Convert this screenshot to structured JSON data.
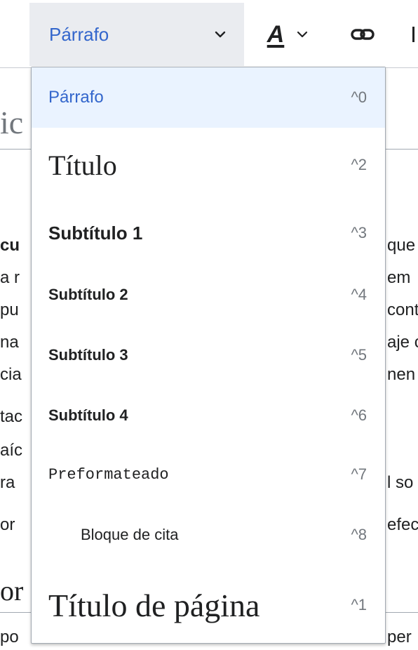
{
  "toolbar": {
    "format_label": "Párrafo",
    "text_style_glyph": "A"
  },
  "background_fragments": {
    "left_heading": "ic",
    "left": [
      "cu",
      "a r",
      "pu",
      "na",
      "cia",
      "tac",
      "aíc",
      "ra",
      "or",
      "or",
      "po"
    ],
    "right": [
      "que",
      "em",
      "cont",
      "aje c",
      "nen",
      "l so",
      "efec",
      "per"
    ]
  },
  "menu": {
    "items": [
      {
        "label": "Párrafo",
        "shortcut": "^0"
      },
      {
        "label": "Título",
        "shortcut": "^2"
      },
      {
        "label": "Subtítulo 1",
        "shortcut": "^3"
      },
      {
        "label": "Subtítulo 2",
        "shortcut": "^4"
      },
      {
        "label": "Subtítulo 3",
        "shortcut": "^5"
      },
      {
        "label": "Subtítulo 4",
        "shortcut": "^6"
      },
      {
        "label": "Preformateado",
        "shortcut": "^7"
      },
      {
        "label": "Bloque de cita",
        "shortcut": "^8"
      },
      {
        "label": "Título de página",
        "shortcut": "^1"
      }
    ]
  },
  "colors": {
    "accent": "#3366cc",
    "selected_bg": "#eaf3ff",
    "toolbar_active_bg": "#eaecf0"
  },
  "icons": {
    "format_chevron": "chevron-down-icon",
    "style_chevron": "chevron-down-icon",
    "link": "link-icon"
  }
}
